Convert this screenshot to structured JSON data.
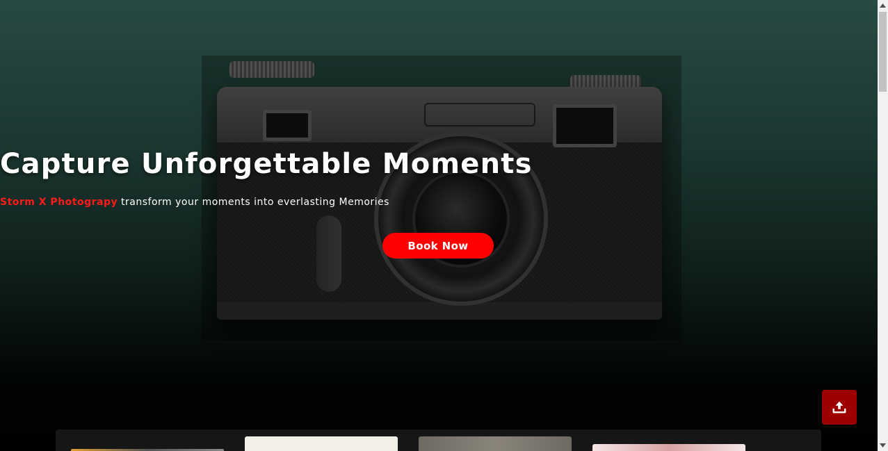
{
  "hero": {
    "title": "Capture Unforgettable Moments",
    "subtitle_brand": "Storm X Photograpy",
    "subtitle_rest": " transform your moments into everlasting Memories",
    "cta_label": "Book Now"
  },
  "colors": {
    "accent": "#ff0000",
    "scroll_top_bg": "#9e0000",
    "hero_gradient_top": "#284a42",
    "page_bg": "#000000"
  },
  "icons": {
    "scroll_top": "upload-arrow-icon"
  }
}
